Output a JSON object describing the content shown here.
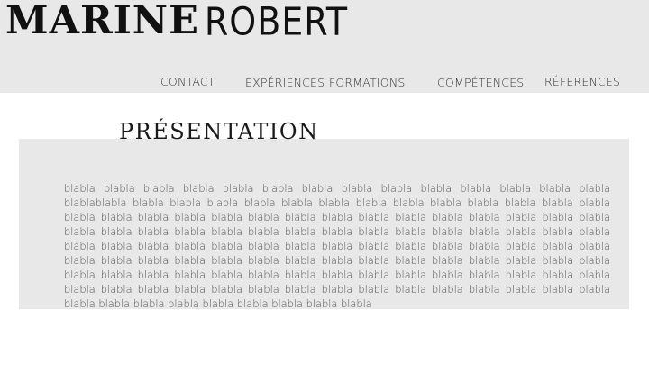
{
  "header": {
    "first_name": "MARINE",
    "last_name": "ROBERT",
    "nav": {
      "contact": "CONTACT",
      "experiences": "EXPÉRIENCES",
      "formations": "FORMATIONS",
      "competences": "COMPÉTENCES",
      "references": "RÉFERENCES"
    }
  },
  "presentation": {
    "title": "PRÉSENTATION",
    "body": "blabla blabla blabla blabla blabla blabla blabla blabla blabla blabla blabla blabla blabla blabla blablablabla blabla blabla blabla blabla blabla blabla blabla blabla blabla blabla blabla blabla blabla blabla blabla blabla blabla blabla blabla blabla blabla blabla blabla blabla blabla blabla blabla blabla blabla blabla blabla blabla blabla blabla blabla blabla blabla blabla blabla blabla blabla blabla blabla blabla blabla blabla blabla blabla blabla blabla blabla blabla blabla blabla blabla blabla blabla blabla blabla blabla blabla blabla blabla blabla blabla blabla blabla blabla blabla blabla blabla blabla blabla blabla blabla blabla blabla blabla blabla blabla blabla blabla blabla blabla blabla blabla blabla blabla blabla blabla blabla blabla blabla blabla blabla blabla blabla blabla blabla blabla blabla blabla blabla blabla blabla blabla blabla blabla blabla blabla blabla blabla"
  },
  "colors": {
    "header_background": "#e8e8e8",
    "panel_background": "#e8e8e8",
    "page_background": "#ffffff",
    "text_dark": "#111111",
    "text_body": "#555555"
  }
}
